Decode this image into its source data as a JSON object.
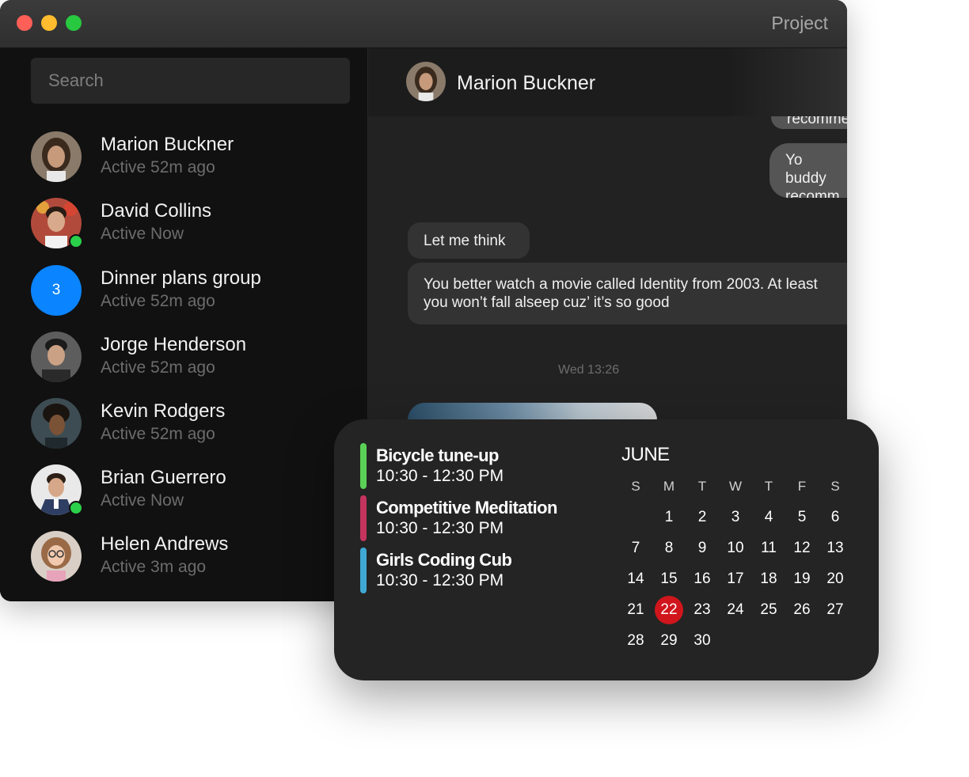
{
  "window": {
    "title": "Project"
  },
  "search": {
    "placeholder": "Search"
  },
  "contacts": [
    {
      "name": "Marion Buckner",
      "status": "Active 52m ago"
    },
    {
      "name": "David Collins",
      "status": "Active Now"
    },
    {
      "name": "Dinner plans group",
      "status": "Active 52m ago",
      "badge": "3"
    },
    {
      "name": "Jorge Henderson",
      "status": "Active 52m ago"
    },
    {
      "name": "Kevin Rodgers",
      "status": "Active 52m ago"
    },
    {
      "name": "Brian Guerrero",
      "status": "Active Now"
    },
    {
      "name": "Helen Andrews",
      "status": "Active 3m ago"
    }
  ],
  "chat": {
    "header_name": "Marion Buckner",
    "messages": [
      {
        "text": "recomme"
      },
      {
        "text": "Yo buddy recomme"
      },
      {
        "text": "Let me think"
      },
      {
        "text": "You better watch a movie called Identity from 2003. At least you won’t fall alseep cuz’ it’s so good"
      }
    ],
    "timestamp": "Wed 13:26"
  },
  "calendar": {
    "events": [
      {
        "title": "Bicycle tune-up",
        "time": "10:30 - 12:30 PM",
        "color": "#5ad156"
      },
      {
        "title": "Competitive Meditation",
        "time": "10:30 - 12:30 PM",
        "color": "#c4345e"
      },
      {
        "title": "Girls Coding Cub",
        "time": "10:30 - 12:30 PM",
        "color": "#3fa9d4"
      }
    ],
    "month": "JUNE",
    "weekdays": [
      "S",
      "M",
      "T",
      "W",
      "T",
      "F",
      "S"
    ],
    "weeks": [
      [
        "",
        "1",
        "2",
        "3",
        "4",
        "5",
        "6"
      ],
      [
        "7",
        "8",
        "9",
        "10",
        "11",
        "12",
        "13"
      ],
      [
        "14",
        "15",
        "16",
        "17",
        "18",
        "19",
        "20"
      ],
      [
        "21",
        "22",
        "23",
        "24",
        "25",
        "26",
        "27"
      ],
      [
        "28",
        "29",
        "30",
        "",
        "",
        "",
        ""
      ]
    ],
    "today": "22",
    "today_color": "#d0161c"
  }
}
